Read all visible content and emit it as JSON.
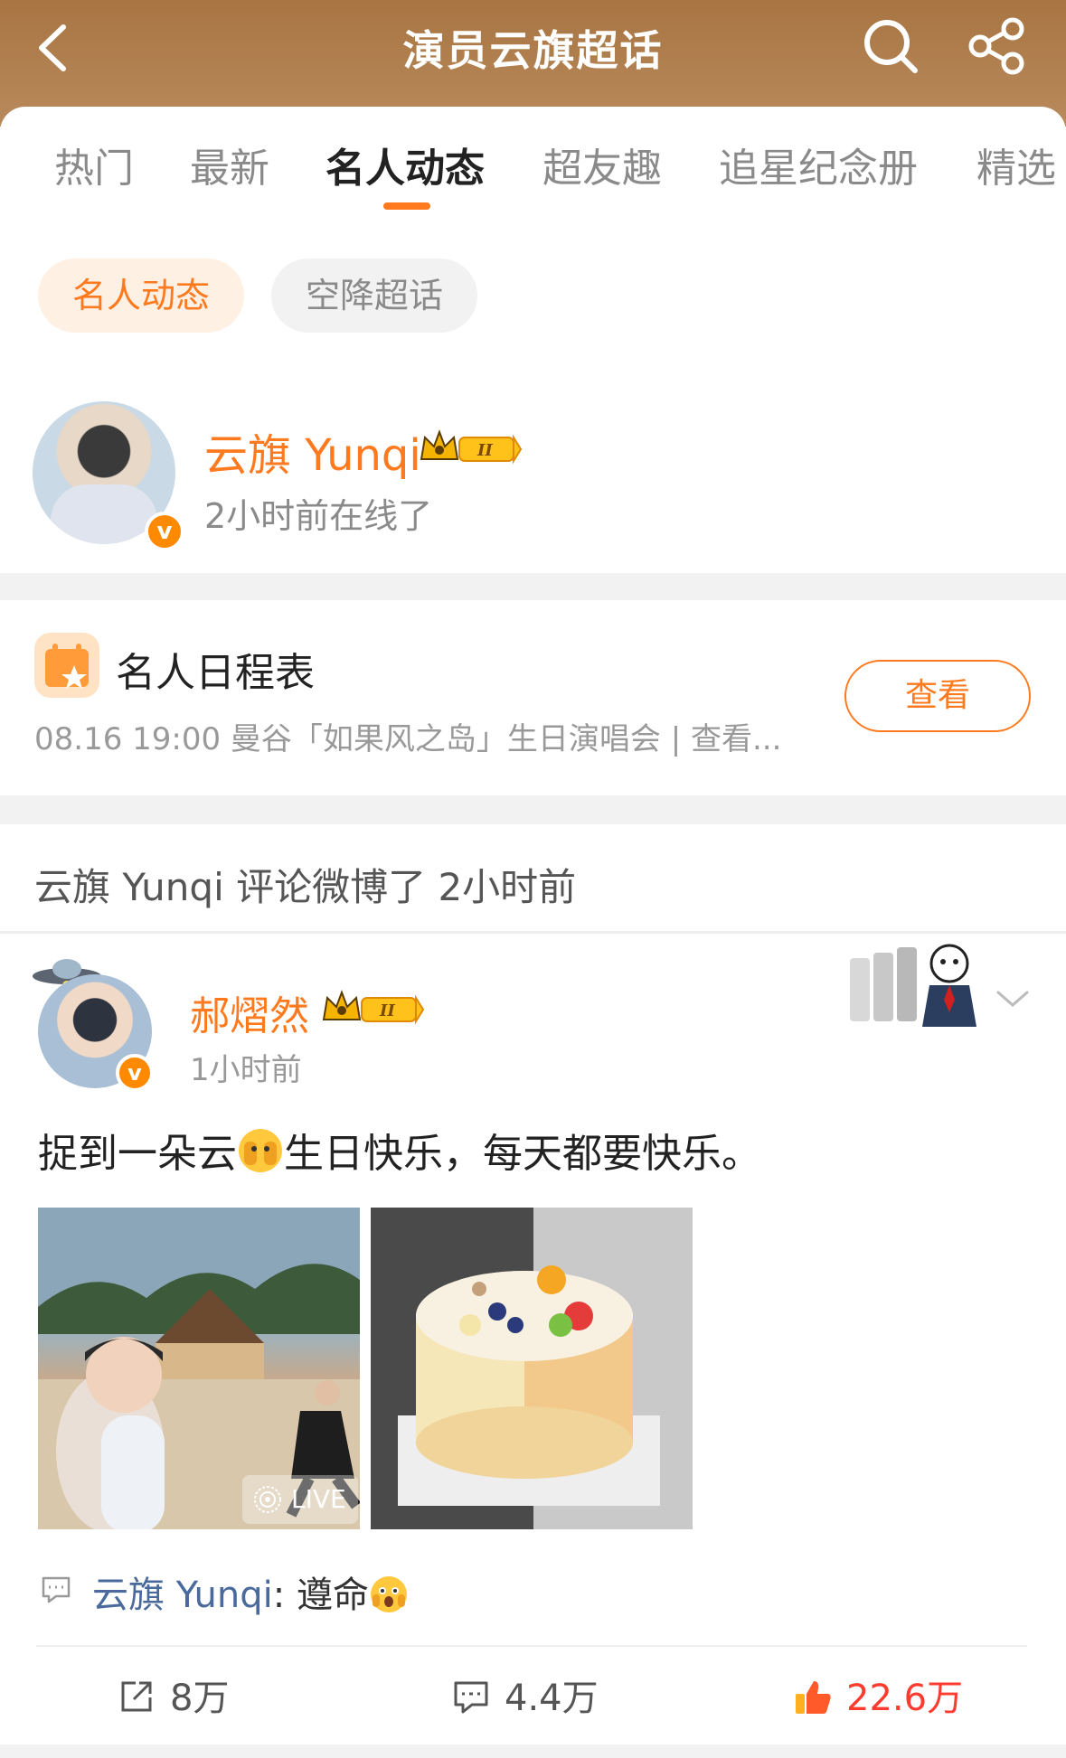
{
  "header": {
    "title": "演员云旗超话",
    "back_icon": "chevron-left-icon",
    "search_icon": "search-icon",
    "share_icon": "share-icon"
  },
  "tabs": [
    "热门",
    "最新",
    "名人动态",
    "超友趣",
    "追星纪念册",
    "精选"
  ],
  "active_tab": "名人动态",
  "chips": {
    "active": "名人动态",
    "other": "空降超话"
  },
  "celebrity": {
    "name": "云旗 Yunqi",
    "status": "2小时前在线了",
    "badge_level": "II"
  },
  "schedule": {
    "title": "名人日程表",
    "line": "08.16 19:00 曼谷「如果风之岛」生日演唱会 |  查看...",
    "button": "查看"
  },
  "activity": {
    "text": "云旗 Yunqi 评论微博了 2小时前"
  },
  "post": {
    "author": "郝熠然",
    "author_badge": "II",
    "time": "1小时前",
    "text_before": "捉到一朵云",
    "text_after": "生日快乐，每天都要快乐。",
    "live_label": "LIVE",
    "reply_author": "云旗 Yunqi",
    "reply_text": ": 遵命",
    "actions": {
      "repost": "8万",
      "comment": "4.4万",
      "like": "22.6万"
    }
  },
  "colors": {
    "accent": "#ff7a1e",
    "header_brown": "#a87542",
    "like_red": "#ff3b2f",
    "link_blue": "#4a6a9c"
  }
}
